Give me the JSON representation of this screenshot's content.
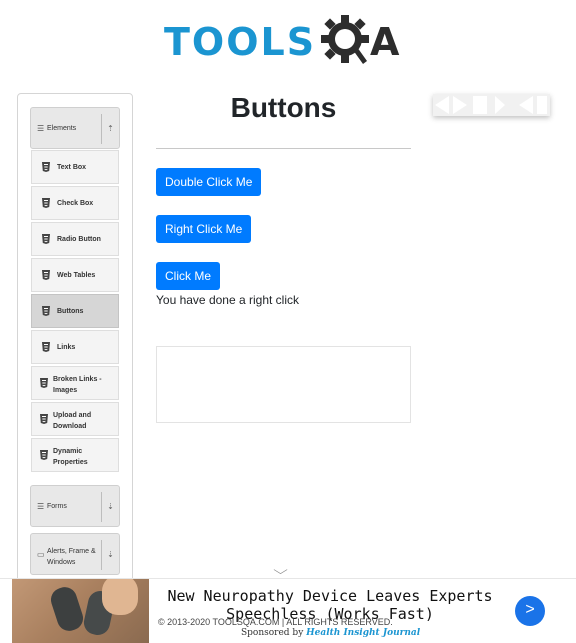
{
  "logo": {
    "prefix": "TOOLS",
    "suffix": "A"
  },
  "sidebar": {
    "elements_label": "Elements",
    "items": [
      {
        "label": "Text Box"
      },
      {
        "label": "Check Box"
      },
      {
        "label": "Radio Button"
      },
      {
        "label": "Web Tables"
      },
      {
        "label": "Buttons",
        "active": true
      },
      {
        "label": "Links"
      },
      {
        "label": "Broken Links - Images"
      },
      {
        "label": "Upload and Download"
      },
      {
        "label": "Dynamic Properties"
      }
    ],
    "forms_label": "Forms",
    "alerts_label": "Alerts, Frame & Windows"
  },
  "main": {
    "title": "Buttons",
    "double_click_label": "Double Click Me",
    "right_click_label": "Right Click Me",
    "click_label": "Click Me",
    "message": "You have done a right click"
  },
  "ad": {
    "headline": "New Neuropathy Device Leaves Experts Speechless (Works Fast)",
    "copyright": "© 2013-2020 TOOLSQA.COM | ALL RIGHTS RESERVED.",
    "sponsor_prefix": "Sponsored by",
    "sponsor_name": "Health Insight Journal",
    "next_label": ">"
  },
  "colors": {
    "brand": "#1b95d1",
    "button": "#007bff",
    "ad_next": "#1a73e8"
  },
  "icons": [
    "gear-icon",
    "hamburger-icon",
    "chevron-up-icon",
    "chevron-down-icon",
    "html5-icon",
    "window-icon"
  ]
}
